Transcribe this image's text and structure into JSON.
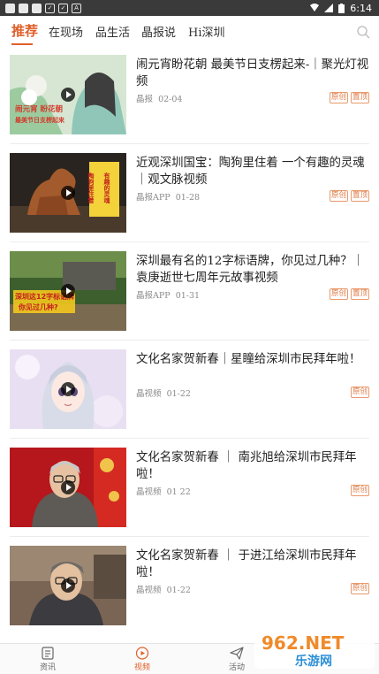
{
  "status_bar": {
    "time": "6:14"
  },
  "tabs": [
    {
      "label": "推荐",
      "active": true
    },
    {
      "label": "在现场",
      "active": false
    },
    {
      "label": "品生活",
      "active": false
    },
    {
      "label": "晶报说",
      "active": false
    },
    {
      "label": "Hi深圳",
      "active": false
    }
  ],
  "items": [
    {
      "title": "闹元宵盼花朝 最美节日支楞起来-｜聚光灯视频",
      "source": "晶报",
      "date": "02-04",
      "badges": [
        "原创",
        "置顶"
      ]
    },
    {
      "title": "近观深圳国宝：陶狗里住着 一个有趣的灵魂｜观文脉视频",
      "source": "晶报APP",
      "date": "01-28",
      "badges": [
        "原创",
        "置顶"
      ]
    },
    {
      "title": "深圳最有名的12字标语牌，你见过几种？｜袁庚逝世七周年元故事视频",
      "source": "晶报APP",
      "date": "01-31",
      "badges": [
        "原创",
        "置顶"
      ]
    },
    {
      "title": "文化名家贺新春｜星瞳给深圳市民拜年啦！",
      "source": "晶视频",
      "date": "01-22",
      "badges": [
        "原创"
      ]
    },
    {
      "title": "文化名家贺新春 ｜ 南兆旭给深圳市民拜年啦！",
      "source": "晶视频",
      "date": "01 22",
      "badges": [
        "原创"
      ]
    },
    {
      "title": "文化名家贺新春 ｜ 于进江给深圳市民拜年啦！",
      "source": "晶视频",
      "date": "01-22",
      "badges": [
        "原创"
      ]
    }
  ],
  "thumb_text": {
    "t1_caption_a": "闹元宵 盼花朝",
    "t1_caption_b": "最美节日支楞起来",
    "t2_caption_a": "陶狗里住着",
    "t2_caption_b": "有趣的灵魂",
    "t3_caption_a": "深圳这12字标语牌",
    "t3_caption_b": "你见过几种?"
  },
  "bottom_nav": [
    {
      "label": "资讯",
      "icon": "news-icon",
      "active": false
    },
    {
      "label": "视频",
      "icon": "video-icon",
      "active": true
    },
    {
      "label": "活动",
      "icon": "paper-plane-icon",
      "active": false
    }
  ],
  "watermark": {
    "line1": "962.NET",
    "line2": "乐游网"
  },
  "colors": {
    "accent": "#e0602b",
    "badge": "#e07a44",
    "status_bar": "#3a3a3a"
  }
}
